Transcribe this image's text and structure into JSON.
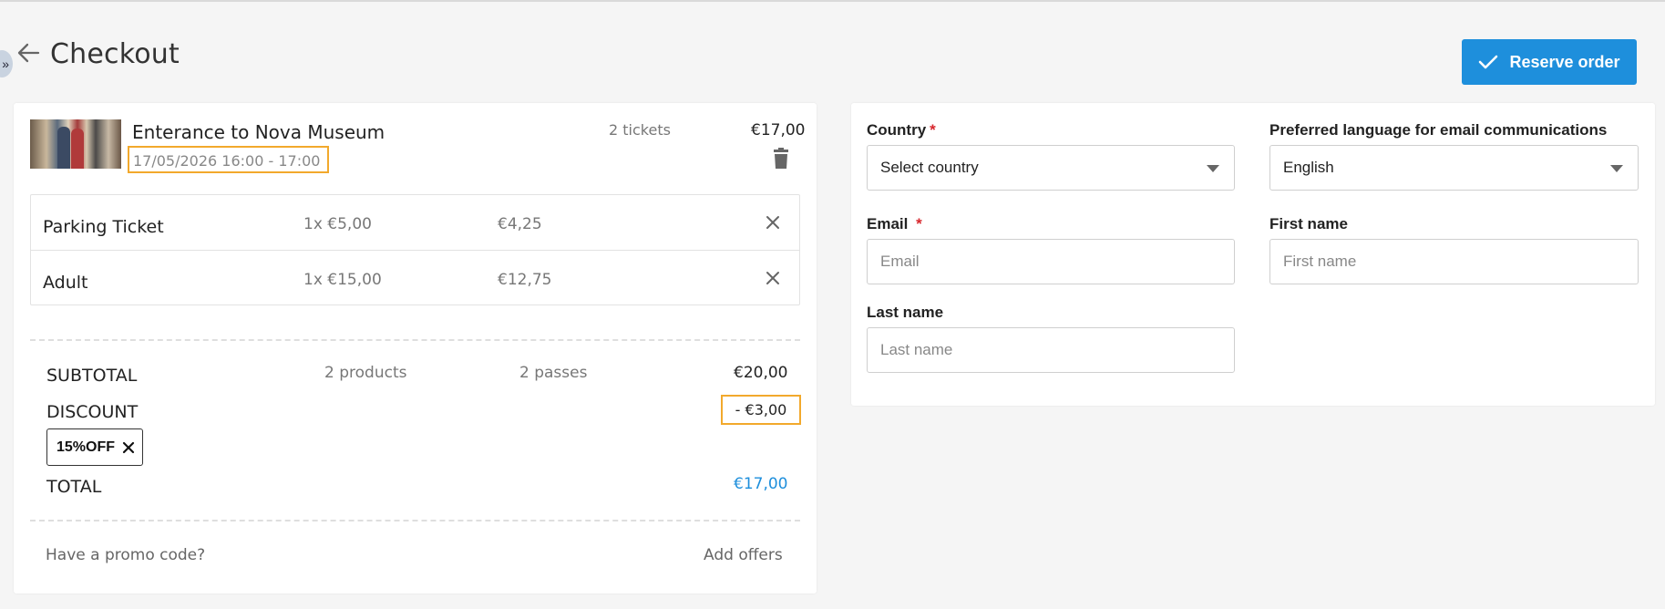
{
  "header": {
    "sidebar_toggle": "»",
    "title": "Checkout",
    "reserve_label": "Reserve order"
  },
  "cart": {
    "event": {
      "title": "Enterance to Nova Museum",
      "date": "17/05/2026 16:00 - 17:00",
      "tickets": "2 tickets",
      "price": "€17,00"
    },
    "items": [
      {
        "name": "Parking Ticket",
        "qty": "1x €5,00",
        "price": "€4,25"
      },
      {
        "name": "Adult",
        "qty": "1x €15,00",
        "price": "€12,75"
      }
    ],
    "summary": {
      "subtotal_label": "SUBTOTAL",
      "products": "2 products",
      "passes": "2 passes",
      "subtotal": "€20,00",
      "discount_label": "DISCOUNT",
      "discount": "- €3,00",
      "promo_code": "15%OFF",
      "total_label": "TOTAL",
      "total": "€17,00"
    },
    "footer": {
      "promo_link": "Have a promo code?",
      "offers_link": "Add offers"
    }
  },
  "form": {
    "country": {
      "label": "Country",
      "required": "*",
      "value": "Select country"
    },
    "language": {
      "label": "Preferred language for email communications",
      "value": "English"
    },
    "email": {
      "label": "Email",
      "required": "*",
      "placeholder": "Email"
    },
    "first_name": {
      "label": "First name",
      "placeholder": "First name"
    },
    "last_name": {
      "label": "Last name",
      "placeholder": "Last name"
    }
  },
  "colors": {
    "accent": "#1e8fdc",
    "highlight": "#f2a92c",
    "required": "#d7262c"
  },
  "icons": [
    "back-arrow-icon",
    "check-icon",
    "trash-icon",
    "close-icon",
    "caret-down-icon",
    "chevron-double-right-icon"
  ]
}
